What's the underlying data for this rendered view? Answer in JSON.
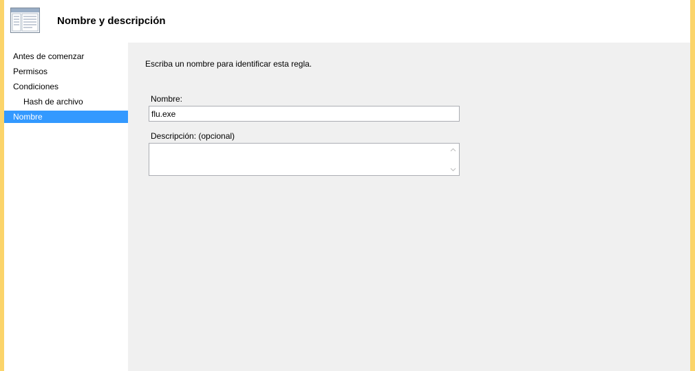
{
  "header": {
    "title": "Nombre y descripción",
    "icon": "wizard-window-icon"
  },
  "sidebar": {
    "items": [
      {
        "label": "Antes de comenzar",
        "selected": false
      },
      {
        "label": "Permisos",
        "selected": false
      },
      {
        "label": "Condiciones",
        "selected": false
      },
      {
        "label": "Hash de archivo",
        "selected": false
      },
      {
        "label": "Nombre",
        "selected": true
      }
    ]
  },
  "content": {
    "instruction": "Escriba un nombre para identificar esta regla.",
    "name_label": "Nombre:",
    "name_value": "flu.exe",
    "description_label": "Descripción: (opcional)",
    "description_value": ""
  },
  "colors": {
    "accent_border": "#fbd46a",
    "selection": "#3399ff"
  }
}
